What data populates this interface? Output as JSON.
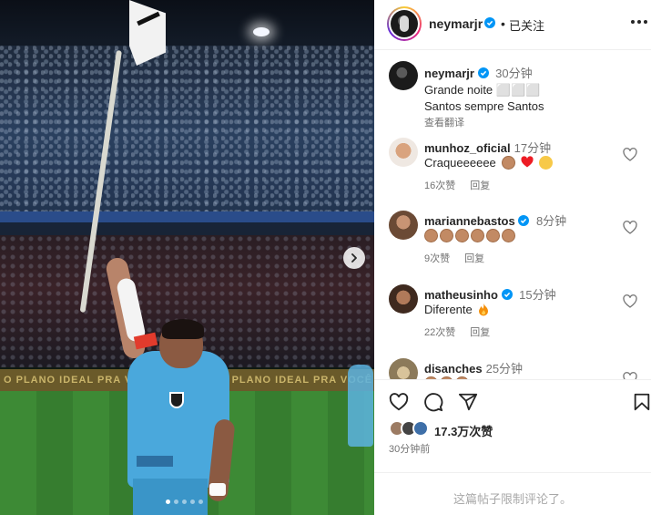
{
  "post": {
    "username": "neymarjr",
    "follow_separator": "•",
    "follow_status": "已关注",
    "photo": {
      "ad_board_text": "O PLANO IDEAL PRA VOCÊ   RESOLAR   O PLANO IDEAL PRA VOCÊ   RESOLAR   O PLANO IDEAL",
      "carousel_total": 5,
      "carousel_active": 1
    },
    "caption": {
      "username": "neymarjr",
      "time": "30分钟",
      "line1": "Grande noite ⬜⬜⬜",
      "line2": "Santos sempre Santos",
      "translate": "查看翻译"
    },
    "comments": [
      {
        "username": "munhoz_oficial",
        "time": "17分钟",
        "text": "Craqueeeeee",
        "likes": "16次赞",
        "reply": "回复"
      },
      {
        "username": "mariannebastos",
        "time": "8分钟",
        "likes": "9次赞",
        "reply": "回复"
      },
      {
        "username": "matheusinho",
        "time": "15分钟",
        "text": "Diferente",
        "likes": "22次赞",
        "reply": "回复"
      },
      {
        "username": "disanches",
        "time": "25分钟"
      }
    ],
    "likes_text": "17.3万次赞",
    "posted_ago": "30分钟前",
    "comments_restricted": "这篇帖子限制评论了。"
  },
  "colors": {
    "verified_blue": "#0095f6",
    "heart_red": "#ed4956",
    "muted_text": "#737373"
  },
  "icons": {
    "like": "heart-outline-icon",
    "comment": "speech-bubble-icon",
    "share": "paper-plane-icon",
    "save": "bookmark-icon",
    "more": "ellipsis-icon",
    "carousel_next": "chevron-right-icon"
  }
}
